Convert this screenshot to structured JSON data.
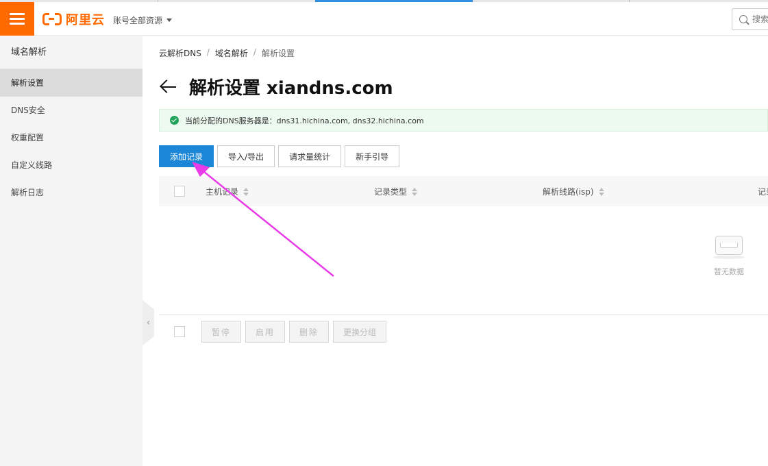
{
  "header": {
    "logo_text": "阿里云",
    "account_label": "账号全部资源",
    "search_placeholder": "搜索"
  },
  "sidebar": {
    "title": "域名解析",
    "items": [
      {
        "label": "解析设置",
        "active": true
      },
      {
        "label": "DNS安全"
      },
      {
        "label": "权重配置"
      },
      {
        "label": "自定义线路"
      },
      {
        "label": "解析日志"
      }
    ]
  },
  "breadcrumb": [
    "云解析DNS",
    "域名解析",
    "解析设置"
  ],
  "breadcrumb_sep": "/",
  "page": {
    "title": "解析设置 xiandns.com",
    "notice": "当前分配的DNS服务器是：dns31.hichina.com, dns32.hichina.com"
  },
  "toolbar": {
    "add_record": "添加记录",
    "import_export": "导入/导出",
    "request_stats": "请求量统计",
    "guide": "新手引导"
  },
  "table": {
    "columns": [
      "主机记录",
      "记录类型",
      "解析线路(isp)",
      "记录"
    ],
    "empty_text": "暂无数据"
  },
  "bulk_actions": {
    "pause": "暂停",
    "enable": "启用",
    "delete": "删除",
    "change_group": "更换分组"
  },
  "colors": {
    "brand": "#ff6a00",
    "primary": "#1b87d6",
    "success": "#21a35a",
    "annotation_arrow": "#e83ce8"
  }
}
